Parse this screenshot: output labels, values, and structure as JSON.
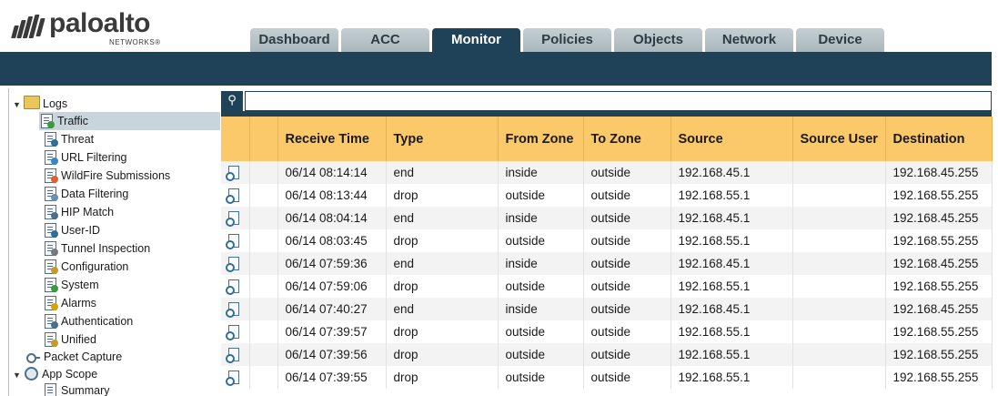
{
  "brand": {
    "name": "paloalto",
    "sub": "NETWORKS®"
  },
  "tabs": [
    {
      "label": "Dashboard",
      "active": false
    },
    {
      "label": "ACC",
      "active": false
    },
    {
      "label": "Monitor",
      "active": true
    },
    {
      "label": "Policies",
      "active": false
    },
    {
      "label": "Objects",
      "active": false
    },
    {
      "label": "Network",
      "active": false
    },
    {
      "label": "Device",
      "active": false
    }
  ],
  "sidebar": {
    "logs_label": "Logs",
    "items": [
      {
        "label": "Traffic",
        "icon": "traffic-log-icon",
        "selected": true
      },
      {
        "label": "Threat",
        "icon": "threat-log-icon"
      },
      {
        "label": "URL Filtering",
        "icon": "url-filtering-log-icon"
      },
      {
        "label": "WildFire Submissions",
        "icon": "wildfire-log-icon"
      },
      {
        "label": "Data Filtering",
        "icon": "data-filtering-log-icon"
      },
      {
        "label": "HIP Match",
        "icon": "hip-match-log-icon"
      },
      {
        "label": "User-ID",
        "icon": "user-id-log-icon"
      },
      {
        "label": "Tunnel Inspection",
        "icon": "tunnel-inspection-log-icon"
      },
      {
        "label": "Configuration",
        "icon": "configuration-log-icon"
      },
      {
        "label": "System",
        "icon": "system-log-icon"
      },
      {
        "label": "Alarms",
        "icon": "alarms-log-icon"
      },
      {
        "label": "Authentication",
        "icon": "authentication-log-icon"
      },
      {
        "label": "Unified",
        "icon": "unified-log-icon"
      }
    ],
    "packet_capture": "Packet Capture",
    "app_scope": "App Scope",
    "summary": "Summary"
  },
  "table": {
    "columns": [
      "",
      "Receive Time",
      "Type",
      "From Zone",
      "To Zone",
      "Source",
      "Source User",
      "Destination"
    ],
    "rows": [
      [
        "06/14 08:14:14",
        "end",
        "inside",
        "outside",
        "192.168.45.1",
        "",
        "192.168.45.255"
      ],
      [
        "06/14 08:13:44",
        "drop",
        "outside",
        "outside",
        "192.168.55.1",
        "",
        "192.168.55.255"
      ],
      [
        "06/14 08:04:14",
        "end",
        "inside",
        "outside",
        "192.168.45.1",
        "",
        "192.168.45.255"
      ],
      [
        "06/14 08:03:45",
        "drop",
        "outside",
        "outside",
        "192.168.55.1",
        "",
        "192.168.55.255"
      ],
      [
        "06/14 07:59:36",
        "end",
        "inside",
        "outside",
        "192.168.45.1",
        "",
        "192.168.45.255"
      ],
      [
        "06/14 07:59:06",
        "drop",
        "outside",
        "outside",
        "192.168.55.1",
        "",
        "192.168.55.255"
      ],
      [
        "06/14 07:40:27",
        "end",
        "inside",
        "outside",
        "192.168.45.1",
        "",
        "192.168.45.255"
      ],
      [
        "06/14 07:39:57",
        "drop",
        "outside",
        "outside",
        "192.168.55.1",
        "",
        "192.168.55.255"
      ],
      [
        "06/14 07:39:56",
        "drop",
        "outside",
        "outside",
        "192.168.55.1",
        "",
        "192.168.55.255"
      ],
      [
        "06/14 07:39:55",
        "drop",
        "outside",
        "outside",
        "192.168.55.1",
        "",
        "192.168.55.255"
      ]
    ]
  },
  "colors": {
    "nav": "#1f4258",
    "header_row": "#fbc86a",
    "tab": "#b7c4c9"
  }
}
